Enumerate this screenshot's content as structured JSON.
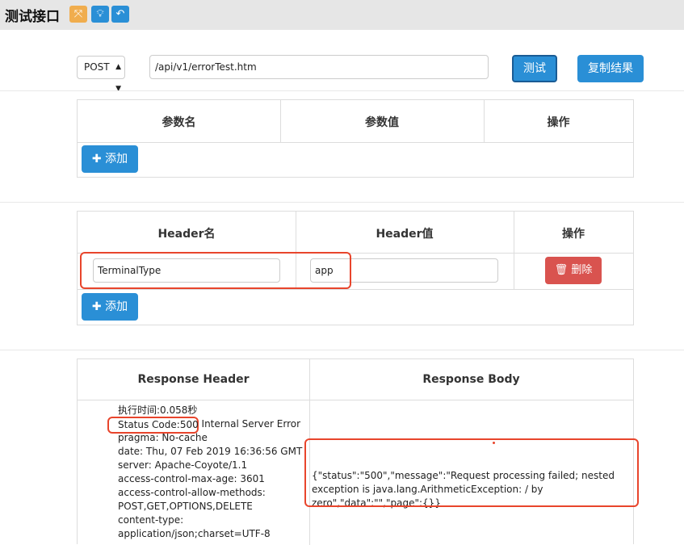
{
  "app": {
    "title": "测试接口"
  },
  "toolbar": {
    "expand_icon": "expand-icon",
    "bulb_icon": "lightbulb-icon",
    "back_icon": "undo-icon"
  },
  "request": {
    "method": "POST",
    "url": "/api/v1/errorTest.htm",
    "test_label": "测试",
    "copy_label": "复制结果"
  },
  "params": {
    "headers": [
      "参数名",
      "参数值",
      "操作"
    ],
    "add_label": "添加"
  },
  "headers_table": {
    "headers": [
      "Header名",
      "Header值",
      "操作"
    ],
    "rows": [
      {
        "name": "TerminalType",
        "value": "app",
        "delete_label": "删除"
      }
    ],
    "add_label": "添加"
  },
  "response": {
    "headers": [
      "Response Header",
      "Response Body"
    ],
    "header_lines": [
      "执行时间:0.058秒",
      "Status Code:500 Internal Server Error",
      "pragma: No-cache",
      "date: Thu, 07 Feb 2019 16:36:56 GMT",
      "server: Apache-Coyote/1.1",
      "access-control-max-age: 3601",
      "access-control-allow-methods:",
      "POST,GET,OPTIONS,DELETE",
      "content-type:",
      "application/json;charset=UTF-8"
    ],
    "body": "{\"status\":\"500\",\"message\":\"Request processing failed; nested exception is java.lang.ArithmeticException: / by zero\",\"data\":\"\",\"page\":{}}"
  },
  "colors": {
    "primary": "#2a8fd6",
    "danger": "#d9534f",
    "warning": "#f0ad4e",
    "highlight": "#e8452c"
  }
}
